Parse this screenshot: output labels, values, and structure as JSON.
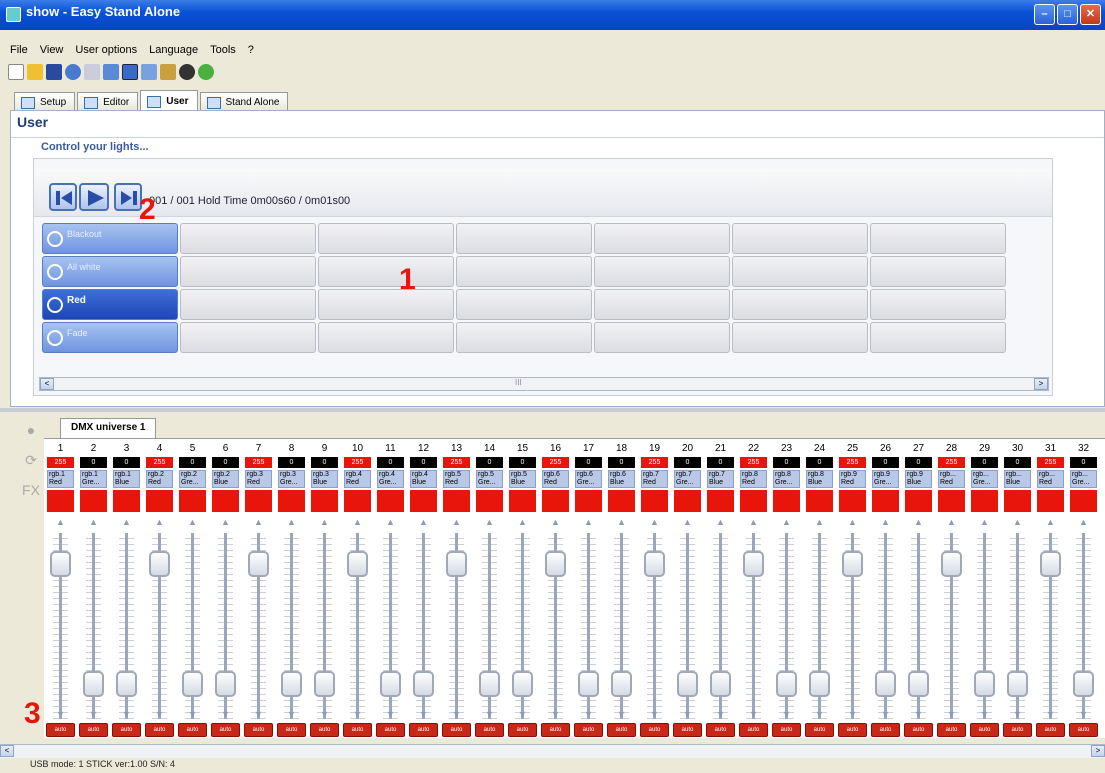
{
  "window": {
    "title": "show - Easy Stand Alone",
    "minimize": "–",
    "maximize": "□",
    "close": "✕"
  },
  "menu": [
    "File",
    "View",
    "User options",
    "Language",
    "Tools",
    "?"
  ],
  "tabs": [
    {
      "label": "Setup"
    },
    {
      "label": "Editor"
    },
    {
      "label": "User"
    },
    {
      "label": "Stand Alone"
    }
  ],
  "user": {
    "title": "User",
    "subtitle": "Control your lights..."
  },
  "player": {
    "status": "001 / 001  Hold Time 0m00s60 / 0m01s00"
  },
  "scenes": [
    {
      "label": "Blackout"
    },
    {
      "label": "All white"
    },
    {
      "label": "Red"
    },
    {
      "label": "Fade"
    }
  ],
  "scroll": {
    "left": "<",
    "right": ">",
    "mid": "III"
  },
  "annotations": {
    "a1": "1",
    "a2": "2",
    "a3": "3"
  },
  "dmx": {
    "tab": "DMX universe 1",
    "channels": [
      {
        "n": "1",
        "v": "255",
        "l": "rgb.1\nRed",
        "c": "#e8160a"
      },
      {
        "n": "2",
        "v": "0",
        "l": "rgb.1\nGre...",
        "c": "#e8160a"
      },
      {
        "n": "3",
        "v": "0",
        "l": "rgb.1\nBlue",
        "c": "#e8160a"
      },
      {
        "n": "4",
        "v": "255",
        "l": "rgb.2\nRed",
        "c": "#e8160a"
      },
      {
        "n": "5",
        "v": "0",
        "l": "rgb.2\nGre...",
        "c": "#e8160a"
      },
      {
        "n": "6",
        "v": "0",
        "l": "rgb.2\nBlue",
        "c": "#e8160a"
      },
      {
        "n": "7",
        "v": "255",
        "l": "rgb.3\nRed",
        "c": "#e8160a"
      },
      {
        "n": "8",
        "v": "0",
        "l": "rgb.3\nGre...",
        "c": "#e8160a"
      },
      {
        "n": "9",
        "v": "0",
        "l": "rgb.3\nBlue",
        "c": "#e8160a"
      },
      {
        "n": "10",
        "v": "255",
        "l": "rgb.4\nRed",
        "c": "#e8160a"
      },
      {
        "n": "11",
        "v": "0",
        "l": "rgb.4\nGre...",
        "c": "#e8160a"
      },
      {
        "n": "12",
        "v": "0",
        "l": "rgb.4\nBlue",
        "c": "#e8160a"
      },
      {
        "n": "13",
        "v": "255",
        "l": "rgb.5\nRed",
        "c": "#e8160a"
      },
      {
        "n": "14",
        "v": "0",
        "l": "rgb.5\nGre...",
        "c": "#e8160a"
      },
      {
        "n": "15",
        "v": "0",
        "l": "rgb.5\nBlue",
        "c": "#e8160a"
      },
      {
        "n": "16",
        "v": "255",
        "l": "rgb.6\nRed",
        "c": "#e8160a"
      },
      {
        "n": "17",
        "v": "0",
        "l": "rgb.6\nGre...",
        "c": "#e8160a"
      },
      {
        "n": "18",
        "v": "0",
        "l": "rgb.6\nBlue",
        "c": "#e8160a"
      },
      {
        "n": "19",
        "v": "255",
        "l": "rgb.7\nRed",
        "c": "#e8160a"
      },
      {
        "n": "20",
        "v": "0",
        "l": "rgb.7\nGre...",
        "c": "#e8160a"
      },
      {
        "n": "21",
        "v": "0",
        "l": "rgb.7\nBlue",
        "c": "#e8160a"
      },
      {
        "n": "22",
        "v": "255",
        "l": "rgb.8\nRed",
        "c": "#e8160a"
      },
      {
        "n": "23",
        "v": "0",
        "l": "rgb.8\nGre...",
        "c": "#e8160a"
      },
      {
        "n": "24",
        "v": "0",
        "l": "rgb.8\nBlue",
        "c": "#e8160a"
      },
      {
        "n": "25",
        "v": "255",
        "l": "rgb.9\nRed",
        "c": "#e8160a"
      },
      {
        "n": "26",
        "v": "0",
        "l": "rgb.9\nGre...",
        "c": "#e8160a"
      },
      {
        "n": "27",
        "v": "0",
        "l": "rgb.9\nBlue",
        "c": "#e8160a"
      },
      {
        "n": "28",
        "v": "255",
        "l": "rgb...\nRed",
        "c": "#e8160a"
      },
      {
        "n": "29",
        "v": "0",
        "l": "rgb...\nGre...",
        "c": "#e8160a"
      },
      {
        "n": "30",
        "v": "0",
        "l": "rgb...\nBlue",
        "c": "#e8160a"
      },
      {
        "n": "31",
        "v": "255",
        "l": "rgb...\nRed",
        "c": "#e8160a"
      },
      {
        "n": "32",
        "v": "0",
        "l": "rgb...\nGre...",
        "c": "#e8160a"
      }
    ],
    "auto": "auto"
  },
  "status": {
    "label": "USB mode: 1 STICK  ver:1.00  S/N: 4"
  }
}
